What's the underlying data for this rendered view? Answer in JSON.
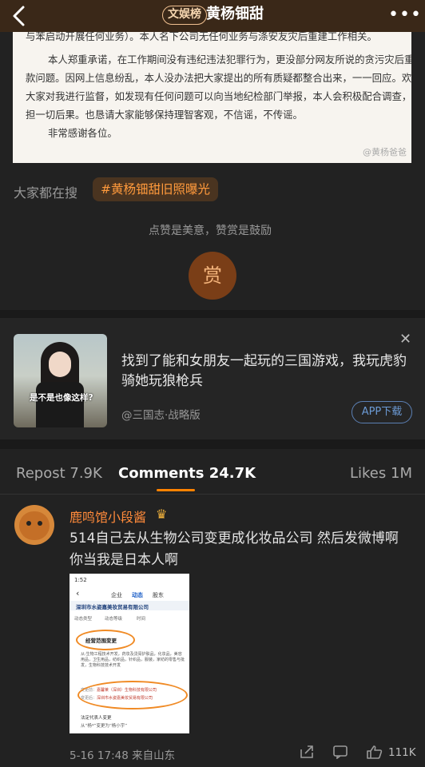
{
  "header": {
    "badge": "文娱榜",
    "title": "黄杨钿甜",
    "more": "•••"
  },
  "statement": {
    "line_partial": "与苯启动开展任何业务）。本人名下公司无任何业务与涤安友灾后重建工作相关。",
    "p1_l1": "本人郑重承诺，在工作期间没有违纪违法犯罪行为，更没部分网友所说的贪污灾后重建",
    "p1_l2": "款问题。因网上信息纷乱，本人没办法把大家提出的所有质疑都整合出来，一一回应。欢迎",
    "p1_l3": "大家对我进行监督，如发现有任何问题可以向当地纪检部门举报，本人会积极配合调查，承",
    "p1_l4": "担一切后果。也恳请大家能够保持理智客观，不信谣，不传谣。",
    "p2": "非常感谢各位。",
    "watermark": "@黄杨爸爸"
  },
  "search": {
    "label": "大家都在搜",
    "tag": "#黄杨钿甜旧照曝光"
  },
  "reward": {
    "text": "点赞是美意，赞赏是鼓励",
    "button": "赏"
  },
  "ad": {
    "image_caption": "是不是也像这样?",
    "text": "找到了能和女朋友一起玩的三国游戏，我玩虎豹骑她玩狼枪兵",
    "source": "@三国志·战略版",
    "button": "APP下载",
    "close": "✕"
  },
  "tabs": {
    "repost": "Repost 7.9K",
    "comments": "Comments 24.7K",
    "likes": "Likes 1M"
  },
  "comment": {
    "username": "鹿鸣馆小段酱",
    "text": "514自己去从生物公司变更成化妆品公司 然后发微博啊 你当我是日本人啊",
    "meta": "5-16 17:48  来自山东",
    "likes": "111K",
    "screenshot": {
      "time": "1:52",
      "tabs": [
        "企业",
        "动态",
        "股东"
      ],
      "company": "深圳市水姿嘉美妆贸易有限公司",
      "filters": [
        "动态类型",
        "动态等级",
        "时间"
      ],
      "item_title": "经营范围变更",
      "item_body": "从:生物工程技术开发，药妆及烫膏护肤品，化妆品，美容用品，卫生用品，纺织品，针织品，服装，家纺的零售与批发，生物科技技术开发",
      "change1_label": "变更前：",
      "change1_value": "嘉馨莱（深圳）生物科技有限公司",
      "change2_label": "变更后：",
      "change2_value": "深圳市水姿嘉美妆贸易有限公司",
      "footer1": "法定代表人变更",
      "footer2": "从“杨*”变更为“杨小宇”"
    }
  }
}
